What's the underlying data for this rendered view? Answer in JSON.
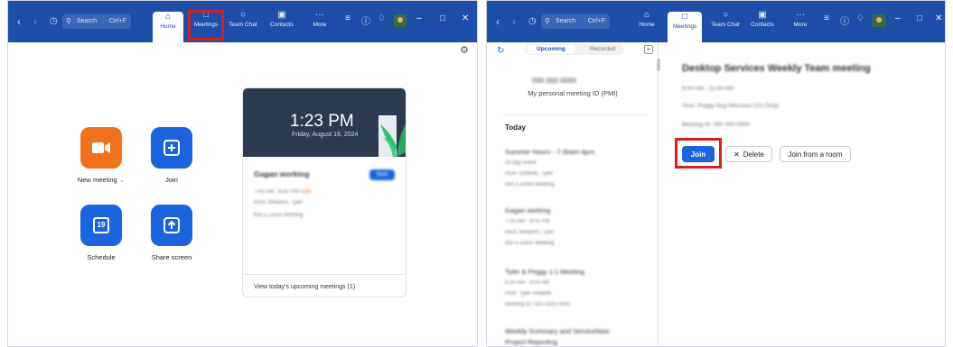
{
  "search": {
    "label": "Search",
    "shortcut": "Ctrl+F"
  },
  "tabs": {
    "home": "Home",
    "meetings": "Meetings",
    "team_chat": "Team Chat",
    "contacts": "Contacts",
    "more": "More"
  },
  "home": {
    "tiles": {
      "new_meeting": "New meeting",
      "join": "Join",
      "schedule": "Schedule",
      "schedule_day": "19",
      "share_screen": "Share screen"
    },
    "card": {
      "time": "1:23 PM",
      "date": "Friday, August 16, 2024",
      "meeting_title": "Gagan working",
      "line1": "7:00 AM - 8:00 PM",
      "line1_tag": "Now",
      "line2": "Host: Williams, Tyler",
      "line3": "Not a Zoom Meeting",
      "join_badge": "Start",
      "footer_link": "View today's upcoming meetings (1)"
    }
  },
  "meetings": {
    "segments": {
      "upcoming": "Upcoming",
      "recorded": "Recorded"
    },
    "pmi_number": "000 000 0000",
    "pmi_label": "My personal meeting ID (PMI)",
    "today_label": "Today",
    "list": [
      {
        "title": "Summer Hours - 7:30am-4pm",
        "lines": [
          "All day event",
          "Host: Gribenk, Tyler",
          "Not a Zoom Meeting"
        ]
      },
      {
        "title": "Gagan working",
        "lines": [
          "7:00 AM - 8:00 PM",
          "Host: Williams, Tyler",
          "Not a Zoom Meeting"
        ]
      },
      {
        "title": "Tyler & Peggy 1:1 Meeting",
        "lines": [
          "8:30 AM - 9:00 AM",
          "Host: Tyler Gribenk",
          "Meeting ID: 000 0000 0000"
        ]
      },
      {
        "title": "Weekly Summary and ServiceNow",
        "lines": [
          "Project Reporting"
        ]
      }
    ],
    "detail": {
      "title": "Desktop Services Weekly Team meeting",
      "line1": "9:00 AM - 11:00 AM",
      "line2": "Host: Peggy Hug-Wilcoxon (Us-Only)",
      "line3": "Meeting ID: 000 000 0000",
      "join": "Join",
      "delete": "Delete",
      "join_room": "Join from a room"
    }
  },
  "colors": {
    "brand": "#1e4fa8",
    "accent": "#1a64e0",
    "orange": "#f2711c",
    "highlight": "#d81f26"
  }
}
